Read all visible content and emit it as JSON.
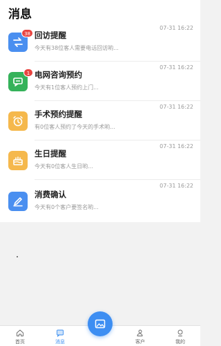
{
  "header": {
    "title": "消息"
  },
  "messages": [
    {
      "title": "回访提醒",
      "subtitle": "今天有38位客人需要电话回访哟...",
      "time": "07-31 16:22",
      "badge": "38",
      "color": "#4a8ff0",
      "icon": "swap-arrows-icon"
    },
    {
      "title": "电网咨询预约",
      "subtitle": "今天有1位客人预约上门...",
      "time": "07-31 16:22",
      "badge": "1",
      "color": "#35b25a",
      "icon": "chat-bubble-icon"
    },
    {
      "title": "手术预约提醒",
      "subtitle": "有0位客人预约了今天的手术哟...",
      "time": "07-31 16:22",
      "badge": "",
      "color": "#f5b84c",
      "icon": "alarm-clock-icon"
    },
    {
      "title": "生日提醒",
      "subtitle": "今天有0位客人生日哟...",
      "time": "07-31 16:22",
      "badge": "",
      "color": "#f5b84c",
      "icon": "birthday-cake-icon"
    },
    {
      "title": "消费确认",
      "subtitle": "今天有0个客户要签名哟...",
      "time": "07-31 16:22",
      "badge": "",
      "color": "#4a8ff0",
      "icon": "pen-icon"
    }
  ],
  "tabbar": {
    "home": "首页",
    "messages": "消息",
    "customers": "客户",
    "mine": "我的"
  },
  "colors": {
    "accent": "#3b8ef0",
    "fab": "#3d8ef2"
  }
}
